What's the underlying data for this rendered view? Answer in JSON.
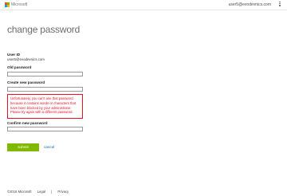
{
  "header": {
    "brand": "Microsoft",
    "user_email": "user5@evodevnics.com",
    "menu_icon": "more-dots-vertical-icon"
  },
  "page": {
    "title": "change password"
  },
  "form": {
    "user_id_label": "User ID",
    "user_id_value": "user5@evodevnics.com",
    "old_password_label": "Old password",
    "old_password_value": "",
    "new_password_label": "Create new password",
    "new_password_value": "",
    "error_message": "Unfortunately, you can't use that password because it contains words or characters that have been blocked by your administrator. Please try again with a different password.",
    "confirm_password_label": "Confirm new password",
    "confirm_password_value": "",
    "submit_label": "submit",
    "cancel_label": "cancel"
  },
  "footer": {
    "copyright": "©2016 Microsoft",
    "legal": "Legal",
    "privacy": "Privacy",
    "separator": "|"
  },
  "colors": {
    "submit": "#7fba00",
    "error": "#e81123",
    "link": "#0067b8",
    "title": "#6d6d6d"
  }
}
